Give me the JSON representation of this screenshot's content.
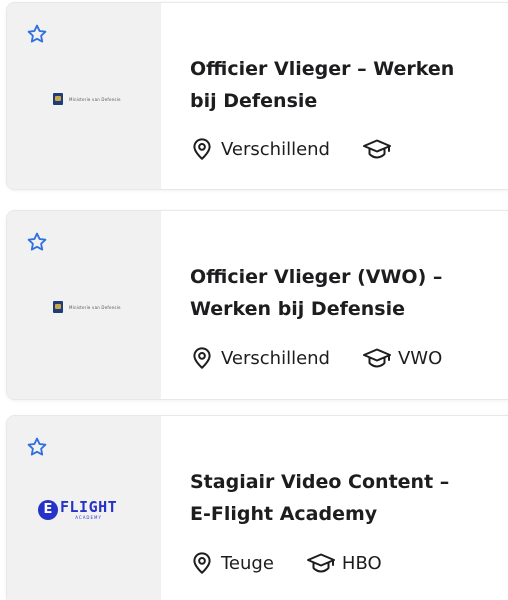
{
  "vacancies": [
    {
      "title": "Officier Vlieger – Werken bij Defensie",
      "title_line1": "Officier Vlieger – Werken",
      "title_line2": "bij Defensie",
      "logo": {
        "type": "ministerie-van-defensie",
        "text": "Ministerie van Defensie"
      },
      "location": "Verschillend",
      "education": ""
    },
    {
      "title": "Officier Vlieger (VWO) – Werken bij Defensie",
      "title_line1": "Officier Vlieger (VWO) –",
      "title_line2": "Werken bij Defensie",
      "logo": {
        "type": "ministerie-van-defensie",
        "text": "Ministerie van Defensie"
      },
      "location": "Verschillend",
      "education": "VWO"
    },
    {
      "title": "Stagiair Video Content – E-Flight Academy",
      "title_line1": "Stagiair Video Content –",
      "title_line2": "E-Flight Academy",
      "logo": {
        "type": "e-flight-academy",
        "letter": "E",
        "word": "FLIGHT",
        "sub": "ACADEMY"
      },
      "location": "Teuge",
      "education": "HBO"
    }
  ],
  "icons": {
    "favorite": "star-outline-icon",
    "location": "map-pin-icon",
    "education": "graduation-cap-icon"
  },
  "colors": {
    "star": "#2f6fe0",
    "text": "#1d1d1f",
    "logo_panel_bg": "#f1f1f2",
    "eflight_blue": "#2633c9"
  }
}
